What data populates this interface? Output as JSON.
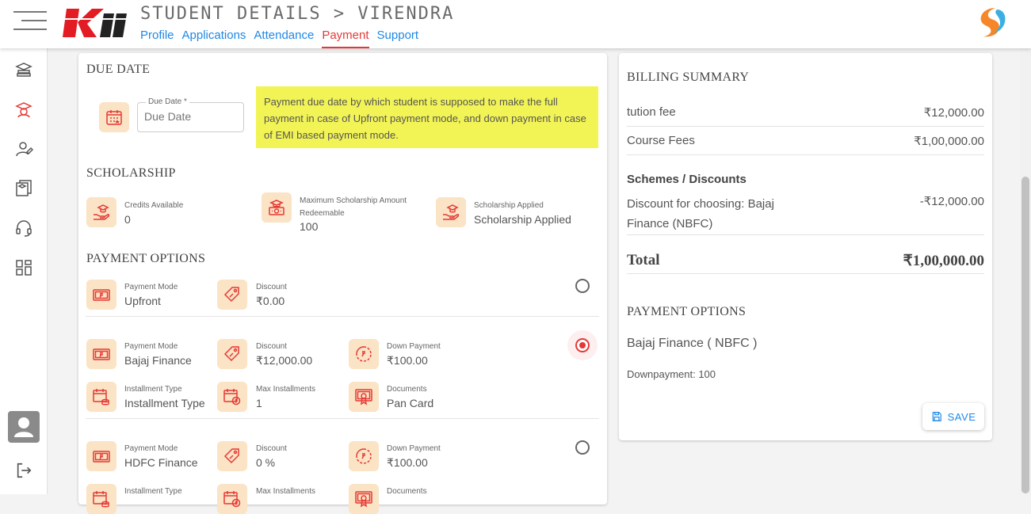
{
  "header": {
    "title": "STUDENT DETAILS > VIRENDRA",
    "tabs": [
      {
        "label": "Profile"
      },
      {
        "label": "Applications"
      },
      {
        "label": "Attendance"
      },
      {
        "label": "Payment",
        "active": true
      },
      {
        "label": "Support"
      }
    ],
    "accent_color": "#e53935",
    "link_color": "#1e88e5"
  },
  "due_date": {
    "section_title": "DUE DATE",
    "field_label": "Due Date *",
    "placeholder": "Due Date",
    "note": "Payment due date by which student is supposed to make the full payment in case of Upfront payment mode, and down payment in case of EMI based payment mode."
  },
  "scholarship": {
    "section_title": "SCHOLARSHIP",
    "items": [
      {
        "label": "Credits Available",
        "value": "0",
        "icon": "hand-cap-icon"
      },
      {
        "label": "Maximum Scholarship Amount Redeemable",
        "value": "100",
        "icon": "cap-money-icon"
      },
      {
        "label": "Scholarship Applied",
        "value": "Scholarship Applied",
        "icon": "hand-cap-icon"
      }
    ]
  },
  "payment_options": {
    "section_title": "PAYMENT OPTIONS",
    "options": [
      {
        "mode_label": "Payment Mode",
        "mode": "Upfront",
        "discount_label": "Discount",
        "discount": "₹0.00",
        "selected": false
      },
      {
        "mode_label": "Payment Mode",
        "mode": "Bajaj Finance",
        "discount_label": "Discount",
        "discount": "₹12,000.00",
        "down_label": "Down Payment",
        "down": "₹100.00",
        "inst_type_label": "Installment Type",
        "inst_type": "Installment Type",
        "max_inst_label": "Max Installments",
        "max_inst": "1",
        "docs_label": "Documents",
        "docs": "Pan Card",
        "selected": true
      },
      {
        "mode_label": "Payment Mode",
        "mode": "HDFC Finance",
        "discount_label": "Discount",
        "discount": "0 %",
        "down_label": "Down Payment",
        "down": "₹100.00",
        "inst_type_label": "Installment Type",
        "max_inst_label": "Max Installments",
        "docs_label": "Documents",
        "selected": false
      }
    ]
  },
  "billing": {
    "title": "BILLING SUMMARY",
    "items": [
      {
        "label": "tution fee",
        "amount": "₹12,000.00"
      },
      {
        "label": "Course Fees",
        "amount": "₹1,00,000.00"
      }
    ],
    "schemes_title": "Schemes / Discounts",
    "discount_label": "Discount for choosing: Bajaj Finance (NBFC)",
    "discount_amount": "-₹12,000.00",
    "total_label": "Total",
    "total_amount": "₹1,00,000.00",
    "payment_options_title": "PAYMENT OPTIONS",
    "selected_option": "Bajaj Finance ( NBFC )",
    "downpayment": "Downpayment: 100",
    "save_label": "SAVE"
  }
}
